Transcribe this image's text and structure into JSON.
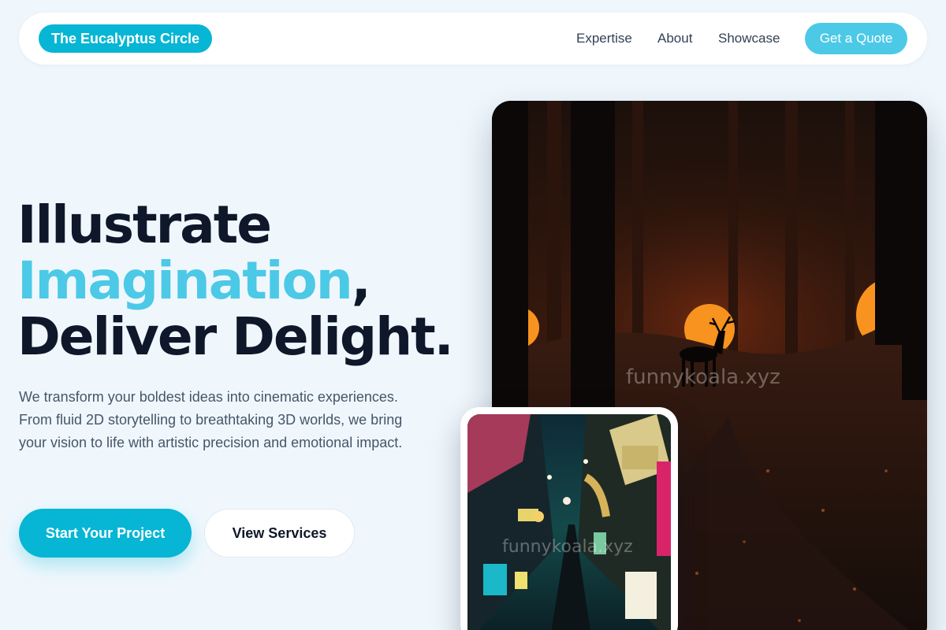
{
  "nav": {
    "brand": "The Eucalyptus Circle",
    "links": [
      "Expertise",
      "About",
      "Showcase"
    ],
    "cta": "Get a Quote"
  },
  "hero": {
    "headline_line1": "Illustrate",
    "headline_accent": "Imagination",
    "headline_comma": ",",
    "headline_line3": "Deliver Delight.",
    "description": "We transform your boldest ideas into cinematic experiences. From fluid 2D storytelling to breathtaking 3D worlds, we bring your vision to life with artistic precision and emotional impact.",
    "primary_button": "Start Your Project",
    "secondary_button": "View Services"
  },
  "images": {
    "forest_watermark": "funnykoala.xyz",
    "alley_watermark": "funnykoala.xyz"
  },
  "colors": {
    "accent": "#06b6d4",
    "accent_light": "#4cc9e6",
    "heading": "#0f172a",
    "body_text": "#475569",
    "background": "#eff7fd"
  }
}
